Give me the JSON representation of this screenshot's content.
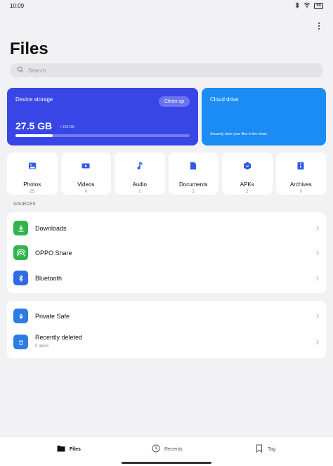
{
  "status_bar": {
    "time": "10:09",
    "battery": "68"
  },
  "header": {
    "title": "Files",
    "search_placeholder": "Search"
  },
  "storage": {
    "label": "Device storage",
    "cleanup_label": "Clean up",
    "used": "27.5 GB",
    "total": "/ 128 GB",
    "used_fraction": 0.215,
    "accent_color": "#3846e6"
  },
  "cloud": {
    "label": "Cloud drive",
    "description": "Securely store your files in the cloud.",
    "accent_color": "#1a8cf3"
  },
  "categories": [
    {
      "name": "Photos",
      "count": "25",
      "icon": "photo-icon"
    },
    {
      "name": "Videos",
      "count": "0",
      "icon": "video-icon"
    },
    {
      "name": "Audio",
      "count": "2",
      "icon": "music-icon"
    },
    {
      "name": "Documents",
      "count": "2",
      "icon": "document-icon"
    },
    {
      "name": "APKs",
      "count": "2",
      "icon": "apk-icon"
    },
    {
      "name": "Archives",
      "count": "0",
      "icon": "archive-icon"
    }
  ],
  "sources": {
    "label": "SOURCES",
    "items": [
      {
        "title": "Downloads",
        "icon": "download-icon",
        "color": "#2fb54a"
      },
      {
        "title": "OPPO Share",
        "icon": "oppo-share-icon",
        "color": "#2fb54a"
      },
      {
        "title": "Bluetooth",
        "icon": "bluetooth-icon",
        "color": "#2f6be6"
      }
    ]
  },
  "private": {
    "items": [
      {
        "title": "Private Safe",
        "icon": "lock-folder-icon",
        "color": "#2f7be6"
      },
      {
        "title": "Recently deleted",
        "subtitle": "0 items",
        "icon": "trash-folder-icon",
        "color": "#2f7be6"
      }
    ]
  },
  "bottom_nav": {
    "items": [
      {
        "label": "Files",
        "icon": "folder-icon",
        "active": true
      },
      {
        "label": "Recents",
        "icon": "clock-icon",
        "active": false
      },
      {
        "label": "Tag",
        "icon": "bookmark-icon",
        "active": false
      }
    ]
  }
}
